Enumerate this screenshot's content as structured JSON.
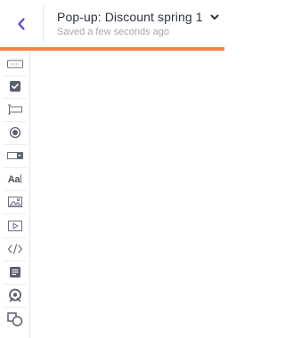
{
  "header": {
    "title": "Pop-up: Discount spring 1",
    "status": "Saved a few seconds ago",
    "back_icon": "chevron-left-icon",
    "dropdown_icon": "chevron-down-icon"
  },
  "colors": {
    "accent": "#f7814b",
    "back_icon": "#4f46e5",
    "title": "#2d3340",
    "subtitle": "#a2a7b2"
  },
  "toolbar": {
    "items": [
      {
        "name": "button-element",
        "icon": "button-icon"
      },
      {
        "name": "checkbox-element",
        "icon": "checkbox-icon"
      },
      {
        "name": "input-element",
        "icon": "input-field-icon"
      },
      {
        "name": "radio-element",
        "icon": "radio-icon"
      },
      {
        "name": "dropdown-element",
        "icon": "dropdown-icon"
      },
      {
        "name": "text-element",
        "icon": "text-icon",
        "label": "Aa"
      },
      {
        "name": "image-element",
        "icon": "image-icon"
      },
      {
        "name": "video-element",
        "icon": "video-icon"
      },
      {
        "name": "html-element",
        "icon": "code-icon"
      },
      {
        "name": "form-element",
        "icon": "form-icon"
      },
      {
        "name": "coupon-element",
        "icon": "coupon-icon"
      },
      {
        "name": "shapes-element",
        "icon": "shapes-icon"
      }
    ]
  }
}
